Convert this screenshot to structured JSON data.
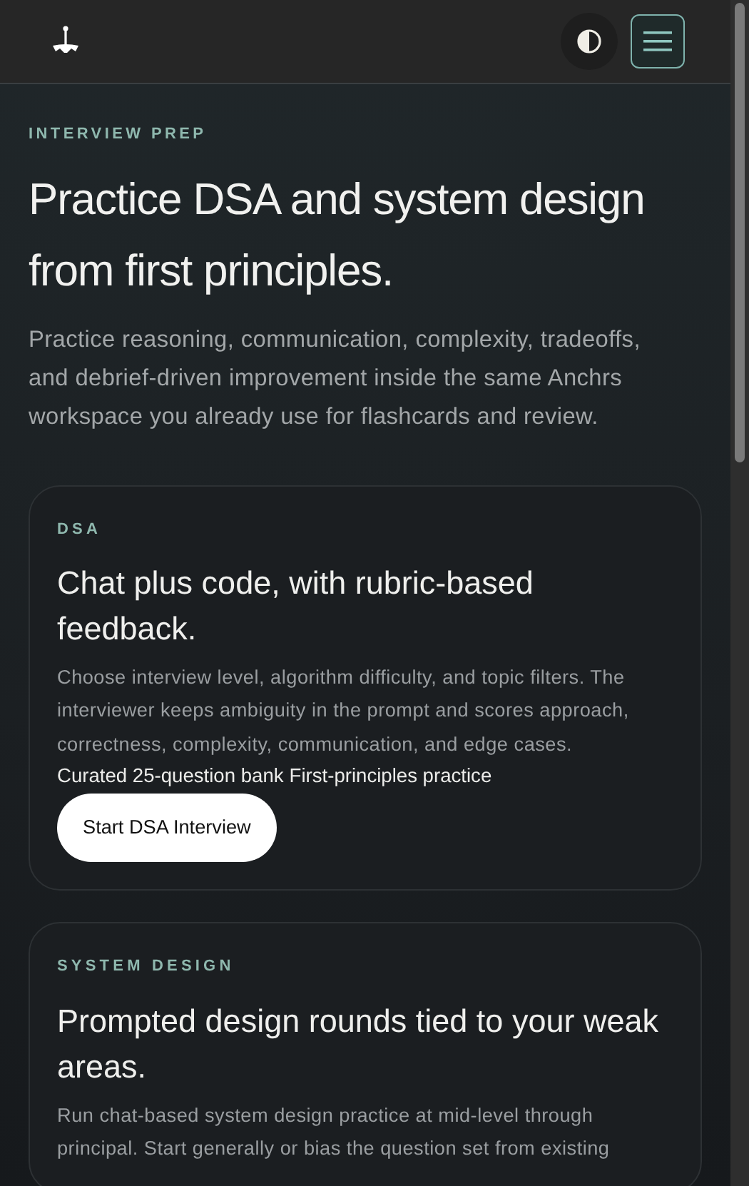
{
  "header": {
    "theme_toggle": {
      "dark": true
    },
    "menu_button": {
      "expanded": false
    }
  },
  "hero": {
    "eyebrow": "INTERVIEW PREP",
    "title": "Practice DSA and system design from first principles.",
    "lead": "Practice reasoning, communication, complexity, tradeoffs, and debrief-driven improvement inside the same Anchrs workspace you already use for flashcards and review."
  },
  "cards": [
    {
      "label": "DSA",
      "title": "Chat plus code, with rubric-based feedback.",
      "description": "Choose interview level, algorithm difficulty, and topic filters. The interviewer keeps ambiguity in the prompt and scores approach, correctness, complexity, communication, and edge cases.",
      "tags": [
        "Curated 25-question bank",
        "First-principles practice"
      ],
      "button": "Start DSA Interview"
    },
    {
      "label": "SYSTEM DESIGN",
      "title": "Prompted design rounds tied to your weak areas.",
      "description": "Run chat-based system design practice at mid-level through principal. Start generally or bias the question set from existing"
    }
  ]
}
